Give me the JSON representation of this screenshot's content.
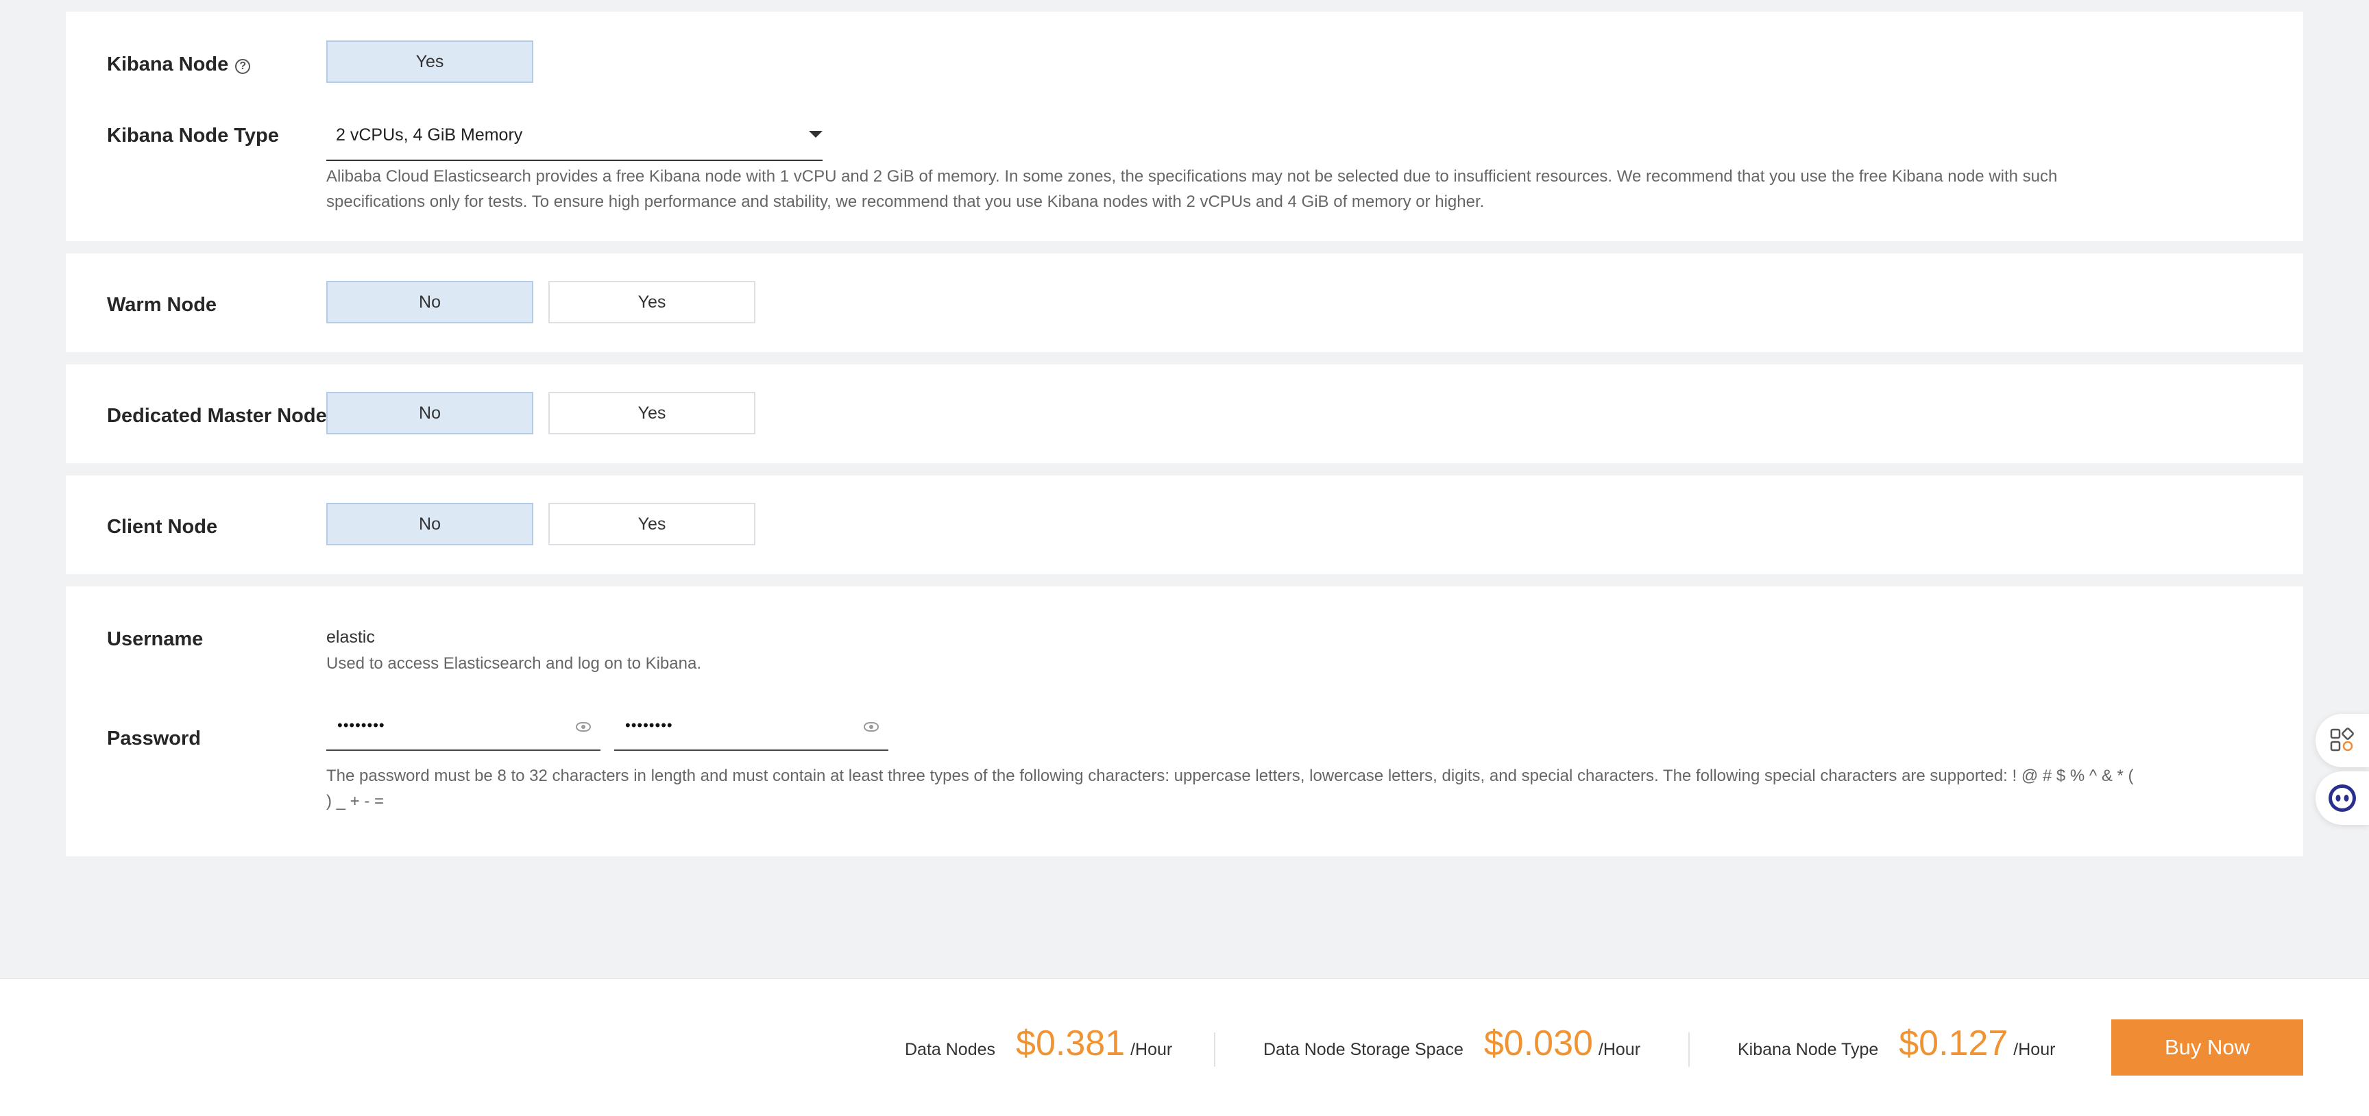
{
  "kibana": {
    "node_label": "Kibana Node",
    "node_options": [
      "Yes"
    ],
    "node_type_label": "Kibana Node Type",
    "node_type_value": "2 vCPUs, 4 GiB Memory",
    "hint_line1": "Alibaba Cloud Elasticsearch provides a free Kibana node with 1 vCPU and 2 GiB of memory. In some zones, the specifications may not be selected due to insufficient resources. We recommend that you use the free Kibana node with such",
    "hint_line2": "specifications only for tests. To ensure high performance and stability, we recommend that you use Kibana nodes with 2 vCPUs and 4 GiB of memory or higher."
  },
  "warm_node": {
    "label": "Warm Node",
    "no": "No",
    "yes": "Yes",
    "selected": "No"
  },
  "master_node": {
    "label": "Dedicated Master Node",
    "no": "No",
    "yes": "Yes",
    "selected": "No"
  },
  "client_node": {
    "label": "Client Node",
    "no": "No",
    "yes": "Yes",
    "selected": "No"
  },
  "account": {
    "username_label": "Username",
    "username_value": "elastic",
    "username_hint": "Used to access Elasticsearch and log on to Kibana.",
    "password_label": "Password",
    "password_mask": "••••••••",
    "confirm_mask": "••••••••",
    "password_hint_line1": "The password must be 8 to 32 characters in length and must contain at least three types of the following characters: uppercase letters, lowercase letters, digits, and special characters. The following special characters are supported: ! @ # $ % ^ & * (",
    "password_hint_line2": ") _ + - ="
  },
  "footer": {
    "items": [
      {
        "label": "Data Nodes",
        "price": "$0.381",
        "unit": "/Hour"
      },
      {
        "label": "Data Node Storage Space",
        "price": "$0.030",
        "unit": "/Hour"
      },
      {
        "label": "Kibana Node Type",
        "price": "$0.127",
        "unit": "/Hour"
      }
    ],
    "buy_label": "Buy Now"
  },
  "colors": {
    "accent_orange": "#ef8c34",
    "selected_bg": "#dde8f5"
  },
  "icons": {
    "help": "question-circle-icon",
    "eye": "eye-icon",
    "float1": "apps-icon",
    "float2": "chatbot-icon"
  }
}
